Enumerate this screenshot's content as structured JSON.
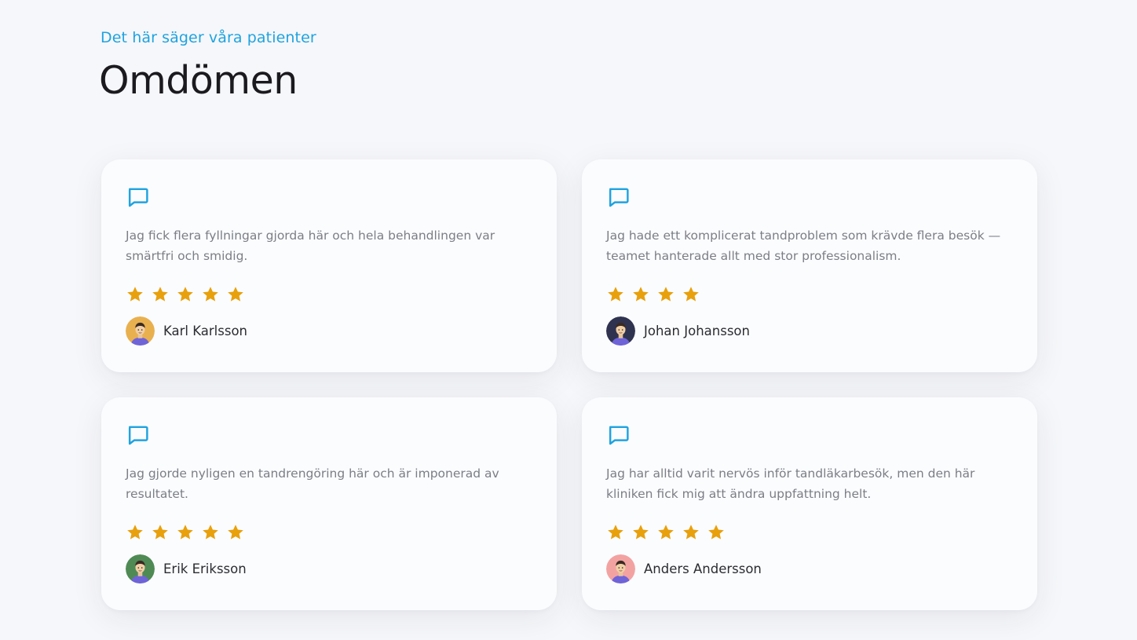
{
  "header": {
    "eyebrow": "Det här säger våra patienter",
    "title": "Omdömen"
  },
  "colors": {
    "accent": "#1fa3e0",
    "star": "#e8a00c",
    "background": "#f6f7fa",
    "card": "#fbfcfe"
  },
  "reviews": [
    {
      "text": "Jag fick flera fyllningar gjorda här och hela behandlingen var smärtfri och smidig.",
      "rating": 5,
      "author": "Karl Karlsson",
      "avatar_color": "#e9b04f"
    },
    {
      "text": "Jag hade ett komplicerat tandproblem som krävde flera besök — teamet hanterade allt med stor professionalism.",
      "rating": 4,
      "author": "Johan Johansson",
      "avatar_color": "#2f3350"
    },
    {
      "text": "Jag gjorde nyligen en tandrengöring här och är imponerad av resultatet.",
      "rating": 5,
      "author": "Erik Eriksson",
      "avatar_color": "#4f8a55"
    },
    {
      "text": "Jag har alltid varit nervös inför tandläkarbesök, men den här kliniken fick mig att ändra uppfattning helt.",
      "rating": 5,
      "author": "Anders Andersson",
      "avatar_color": "#f3a2a2"
    }
  ],
  "icons": {
    "quote": "message-square-icon",
    "star": "star-icon",
    "avatar": "avatar"
  }
}
